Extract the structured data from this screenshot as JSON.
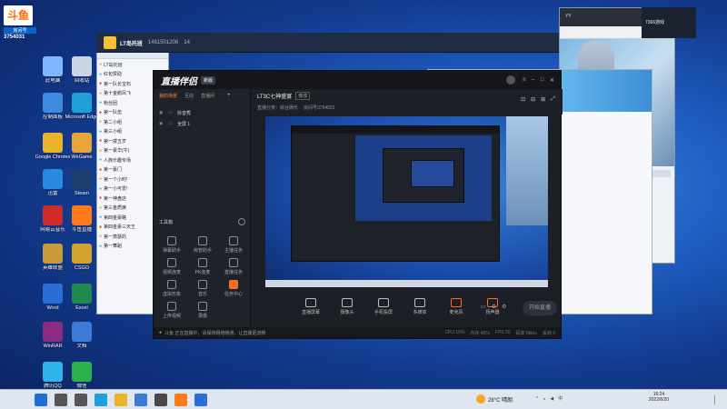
{
  "overlay": {
    "brand": "斗鱼",
    "brand_sub": "房间号",
    "room_number": "3754031",
    "top_right_label": "YY"
  },
  "desktop_icons": [
    {
      "label": "此电脑",
      "color": "#7fb6ff"
    },
    {
      "label": "回收站",
      "color": "#c9d6e6"
    },
    {
      "label": "控制面板",
      "color": "#3c8be0"
    },
    {
      "label": "Microsoft Edge",
      "color": "#1fa0d8"
    },
    {
      "label": "Google Chrome",
      "color": "#e9b32a"
    },
    {
      "label": "WeGame",
      "color": "#e8a43a"
    },
    {
      "label": "迅雷",
      "color": "#2a8ae0"
    },
    {
      "label": "Steam",
      "color": "#1c3f6b"
    },
    {
      "label": "网易云音乐",
      "color": "#d02b2b"
    },
    {
      "label": "斗鱼直播",
      "color": "#ff7a1a"
    },
    {
      "label": "英雄联盟",
      "color": "#c79a3a"
    },
    {
      "label": "CSGO",
      "color": "#d4a22e"
    },
    {
      "label": "Word",
      "color": "#2b6fd6"
    },
    {
      "label": "Excel",
      "color": "#1f8a4c"
    },
    {
      "label": "WinRAR",
      "color": "#8a2c82"
    },
    {
      "label": "文档",
      "color": "#3d7ad6"
    },
    {
      "label": "腾讯QQ",
      "color": "#2fb3e8"
    },
    {
      "label": "微信",
      "color": "#2bb24c"
    }
  ],
  "chat_window": {
    "title": "LT岛托班",
    "id": "1461501208",
    "members": "14",
    "list": [
      "LT岛托班",
      "红包赞助",
      "第一队长宝石",
      "第十金鹅凤飞",
      "粉丝团",
      "第一队伍",
      "第二小组",
      "第三小组",
      "第一拨五岁",
      "第一豪华(牛)",
      "人族乐趣专场",
      "第一豪门",
      "第一个小时!",
      "第一小可爱!",
      "第一神盘店",
      "第三金质席",
      "第四金豪路",
      "第四金豪三天王",
      "第一萧瑟的",
      "第一舞蹈"
    ]
  },
  "main_window": {
    "app_title": "直播伴侣",
    "version_badge": "新版",
    "tabs": [
      "我的场景",
      "互动",
      "直播间"
    ],
    "scene_items": [
      "抖音秀",
      "全屏 1"
    ],
    "broadcast_title": "LT3C七神盛宴",
    "edit_label": "修改",
    "room_info": "直播分类：综合娱乐",
    "room_number_label": "房间号3754031",
    "tools_label": "工具箱",
    "tools": [
      "弹幕助手",
      "房管助手",
      "主播任务",
      "视频连麦",
      "PK连麦",
      "直播任务",
      "虚拟形象",
      "音乐",
      "任务中心",
      "上传视频",
      "录像"
    ],
    "bottom_tools": [
      "直播屏幕",
      "摄像头",
      "手机投屏",
      "多媒体",
      "麦克风",
      "扬声器"
    ],
    "start_button": "开始直播",
    "status_text": "斗鱼 正在直播中，请保持网络畅通，让直播更流畅",
    "stats": [
      "CPU 10%",
      "内存 45%",
      "FPS 30",
      "码率 0kb/s",
      "丢帧 0"
    ]
  },
  "browser_window": {
    "title": "7366游戏",
    "tab_labels": [
      "斗鱼直播",
      "7366游戏"
    ]
  },
  "taskbar": {
    "weather": "28°C 晴朗",
    "time": "16:24",
    "date": "2022/6/20",
    "app_icons": [
      "start-icon",
      "search-icon",
      "taskview-icon",
      "edge-icon",
      "explorer-icon",
      "store-icon",
      "game-icon",
      "douyu-icon",
      "word-icon"
    ]
  }
}
